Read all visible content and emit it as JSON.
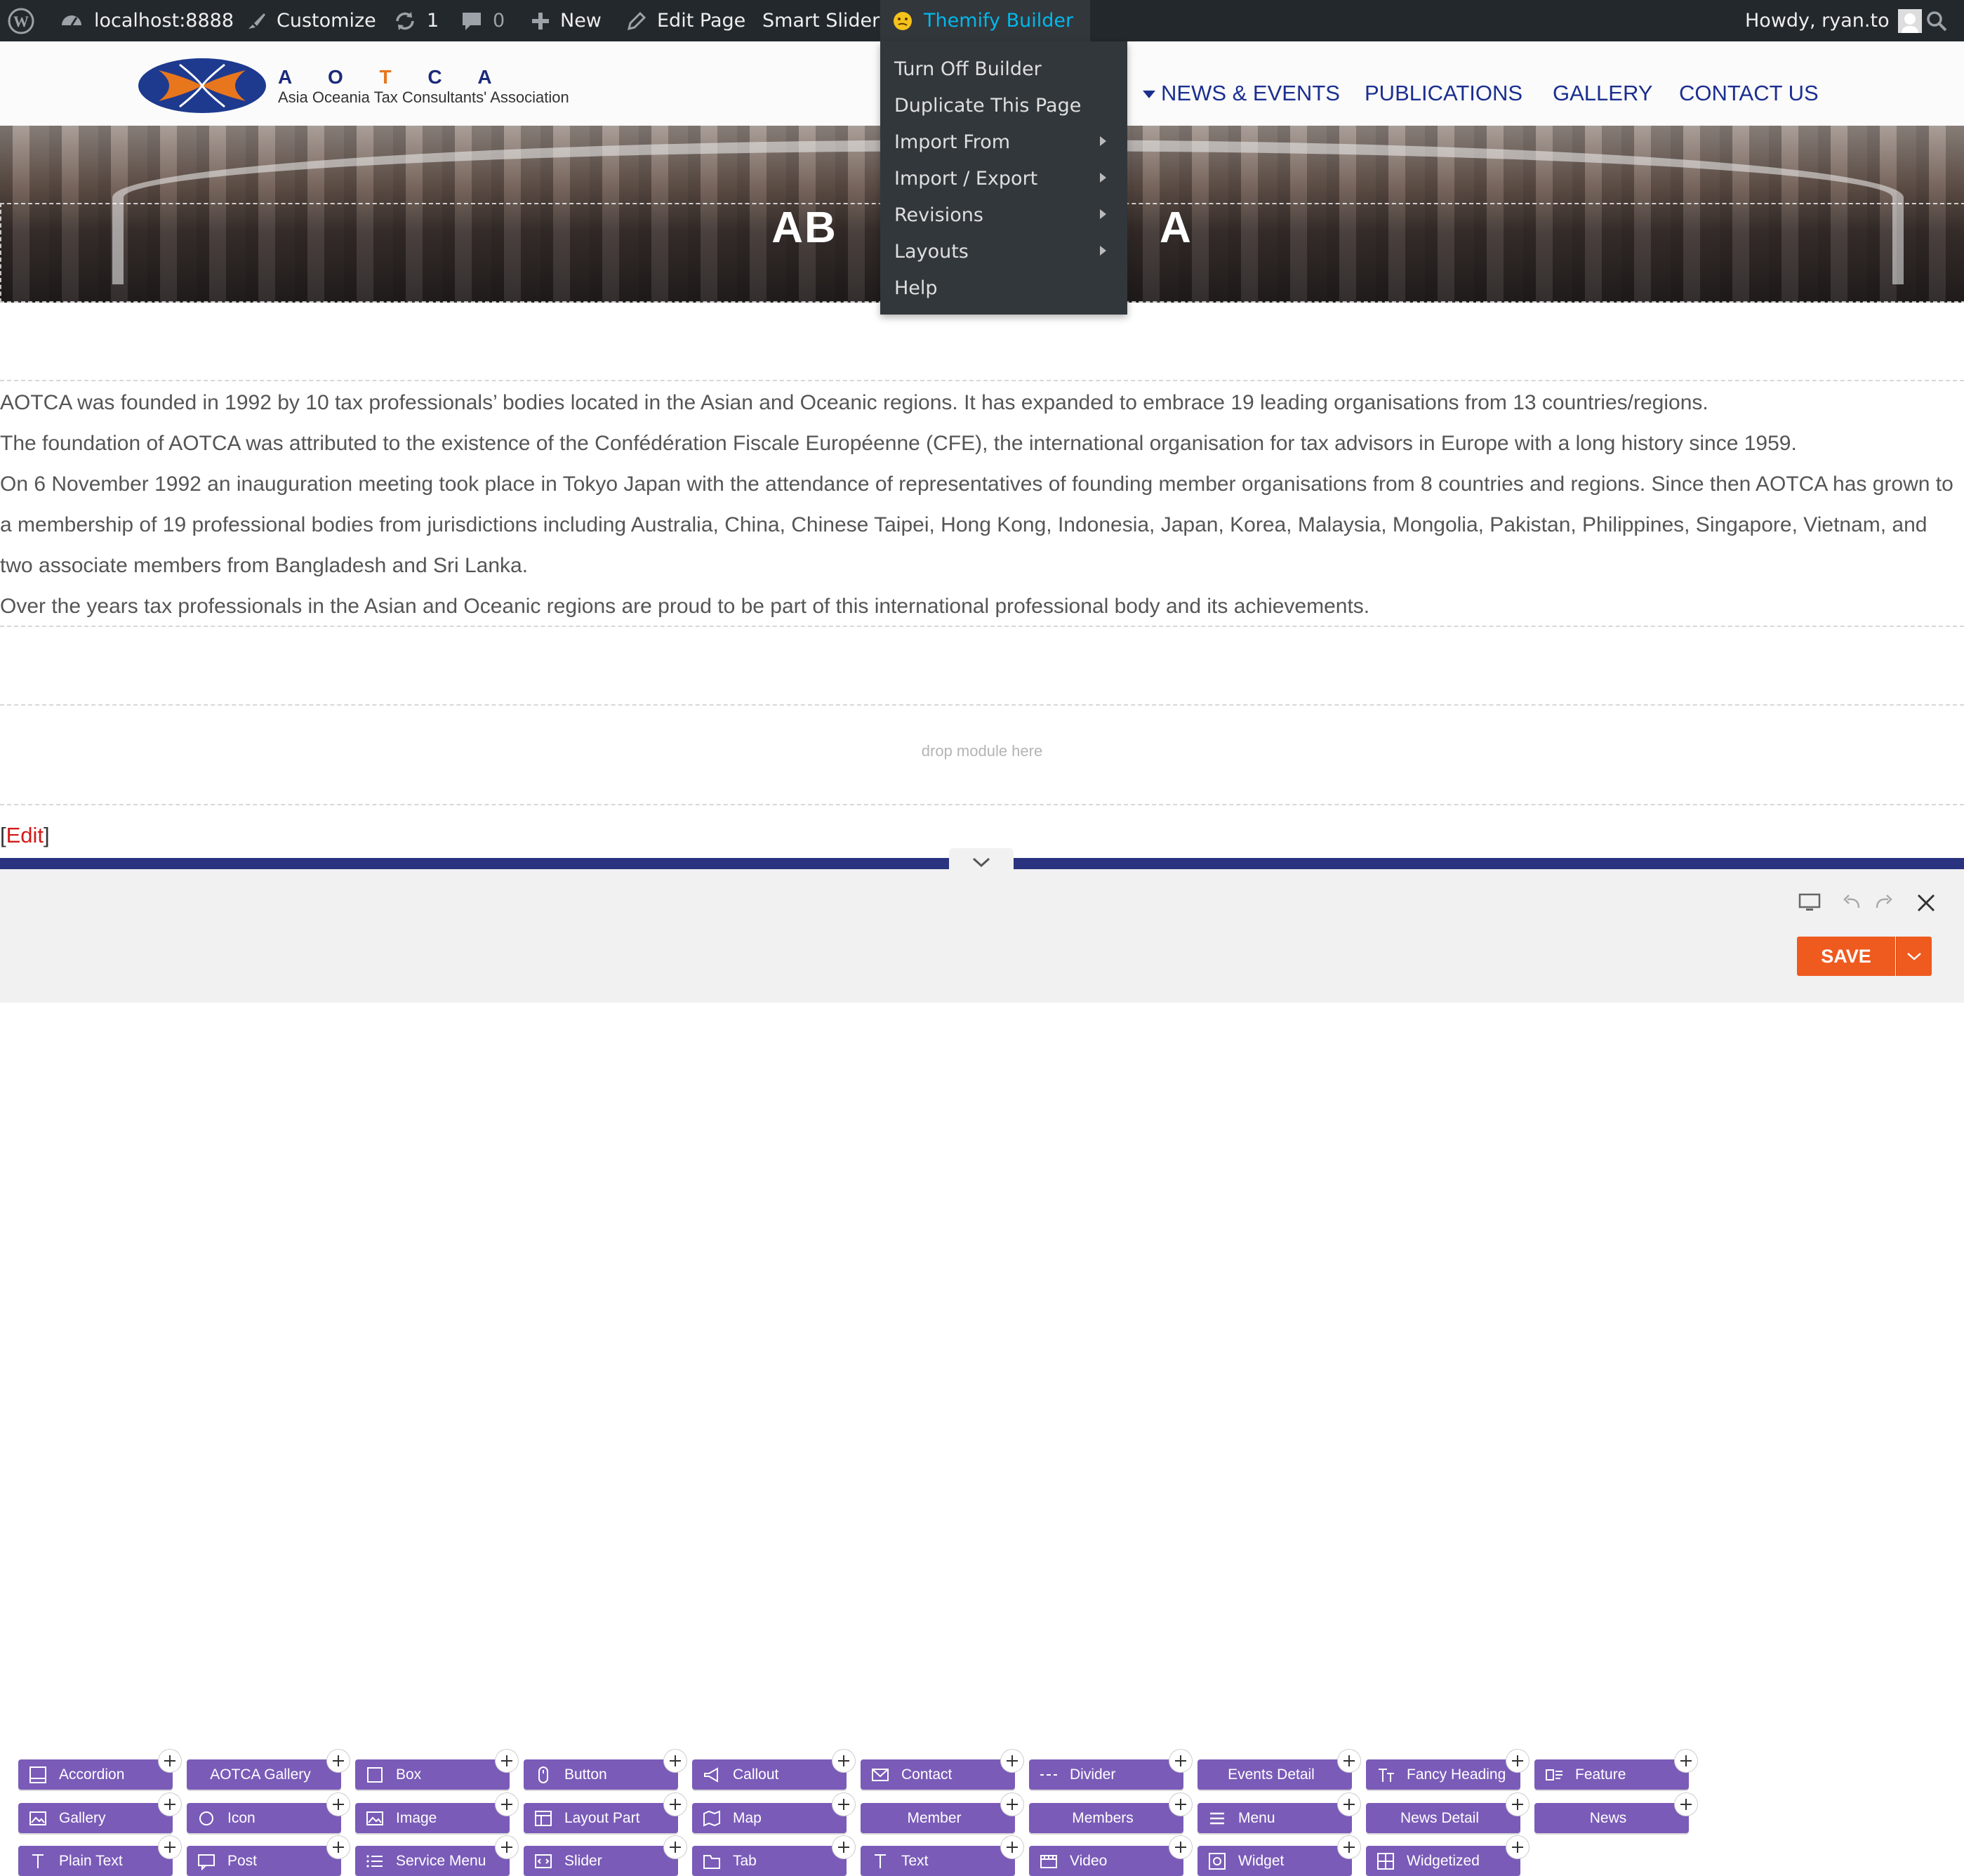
{
  "adminbar": {
    "site": "localhost:8888",
    "customize": "Customize",
    "updates_count": "1",
    "comments_count": "0",
    "new": "New",
    "edit_page": "Edit Page",
    "smart_slider": "Smart Slider",
    "themify": "Themify Builder",
    "howdy": "Howdy, ryan.to"
  },
  "site": {
    "logo_name_pre": "A O ",
    "logo_name_t": "T",
    "logo_name_post": " C A",
    "logo_sub": "Asia Oceania Tax Consultants' Association",
    "nav": [
      "NEWS & EVENTS",
      "PUBLICATIONS",
      "GALLERY",
      "CONTACT US"
    ],
    "hero_title": "AB                        A"
  },
  "themify_menu": {
    "items": [
      "Turn Off Builder",
      "Duplicate This Page",
      "Import From",
      "Import / Export",
      "Revisions",
      "Layouts",
      "Help"
    ]
  },
  "content": {
    "p1": "AOTCA was founded in 1992 by 10 tax professionals’ bodies located in the Asian and Oceanic regions. It has expanded to embrace 19 leading organisations from 13 countries/regions.",
    "p2": "The foundation of AOTCA was attributed to the existence of the Confédération Fiscale Européenne (CFE), the international organisation for tax advisors in Europe with a long history since 1959.",
    "p3": "On 6 November 1992 an inauguration meeting took place in Tokyo Japan with the attendance of representatives of founding member organisations from 8 countries and regions. Since then AOTCA has grown to a membership of 19 professional bodies from jurisdictions including Australia, China, Chinese Taipei, Hong Kong, Indonesia, Japan, Korea, Malaysia, Mongolia, Pakistan, Philippines, Singapore, Vietnam, and two associate members from Bangladesh and Sri Lanka.",
    "p4": "Over the years tax professionals in the Asian and Oceanic regions are proud to be part of this international professional body and its achievements.",
    "drop_module": "drop module here",
    "edit_open": "[",
    "edit": "Edit",
    "edit_close": "]"
  },
  "builder": {
    "modules": [
      {
        "label": "Accordion",
        "icon": "accordion-icon"
      },
      {
        "label": "AOTCA Gallery",
        "icon": ""
      },
      {
        "label": "Box",
        "icon": "box-icon"
      },
      {
        "label": "Button",
        "icon": "button-icon"
      },
      {
        "label": "Callout",
        "icon": "callout-icon"
      },
      {
        "label": "Contact",
        "icon": "contact-icon"
      },
      {
        "label": "Divider",
        "icon": "divider-icon"
      },
      {
        "label": "Events Detail",
        "icon": ""
      },
      {
        "label": "Fancy Heading",
        "icon": "fancy-heading-icon"
      },
      {
        "label": "Feature",
        "icon": "feature-icon"
      },
      {
        "label": "Gallery",
        "icon": "gallery-icon"
      },
      {
        "label": "Icon",
        "icon": "icon-icon"
      },
      {
        "label": "Image",
        "icon": "image-icon"
      },
      {
        "label": "Layout Part",
        "icon": "layout-part-icon"
      },
      {
        "label": "Map",
        "icon": "map-icon"
      },
      {
        "label": "Member",
        "icon": ""
      },
      {
        "label": "Members",
        "icon": ""
      },
      {
        "label": "Menu",
        "icon": "menu-icon"
      },
      {
        "label": "News Detail",
        "icon": ""
      },
      {
        "label": "News",
        "icon": ""
      },
      {
        "label": "Plain Text",
        "icon": "plain-text-icon"
      },
      {
        "label": "Post",
        "icon": "post-icon"
      },
      {
        "label": "Service Menu",
        "icon": "service-menu-icon"
      },
      {
        "label": "Slider",
        "icon": "slider-icon"
      },
      {
        "label": "Tab",
        "icon": "tab-icon"
      },
      {
        "label": "Text",
        "icon": "text-icon"
      },
      {
        "label": "Video",
        "icon": "video-icon"
      },
      {
        "label": "Widget",
        "icon": "widget-icon"
      },
      {
        "label": "Widgetized",
        "icon": "widgetized-icon"
      }
    ],
    "save": "SAVE"
  },
  "colors": {
    "adminbar": "#23282d",
    "nav": "#1b2f8f",
    "module": "#7a5bb8",
    "save": "#ef5a1f",
    "edit_link": "#d51a1a",
    "themify_text": "#00b9eb"
  }
}
